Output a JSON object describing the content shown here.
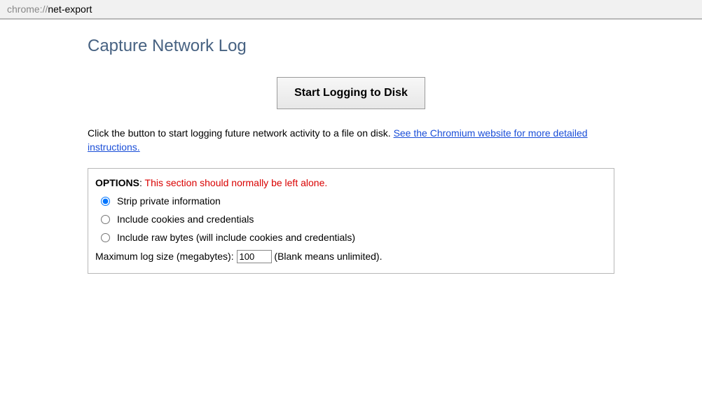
{
  "address": {
    "scheme": "chrome://",
    "path": "net-export"
  },
  "page": {
    "title": "Capture Network Log"
  },
  "button": {
    "start_label": "Start Logging to Disk"
  },
  "instructions": {
    "text": "Click the button to start logging future network activity to a file on disk. ",
    "link_text": "See the Chromium website for more detailed instructions."
  },
  "options": {
    "header_label": "OPTIONS",
    "header_colon": ": ",
    "warning": "This section should normally be left alone.",
    "radios": [
      {
        "label": "Strip private information",
        "checked": true
      },
      {
        "label": "Include cookies and credentials",
        "checked": false
      },
      {
        "label": "Include raw bytes (will include cookies and credentials)",
        "checked": false
      }
    ],
    "max_size_label": "Maximum log size (megabytes): ",
    "max_size_value": "100",
    "max_size_hint": " (Blank means unlimited)."
  }
}
